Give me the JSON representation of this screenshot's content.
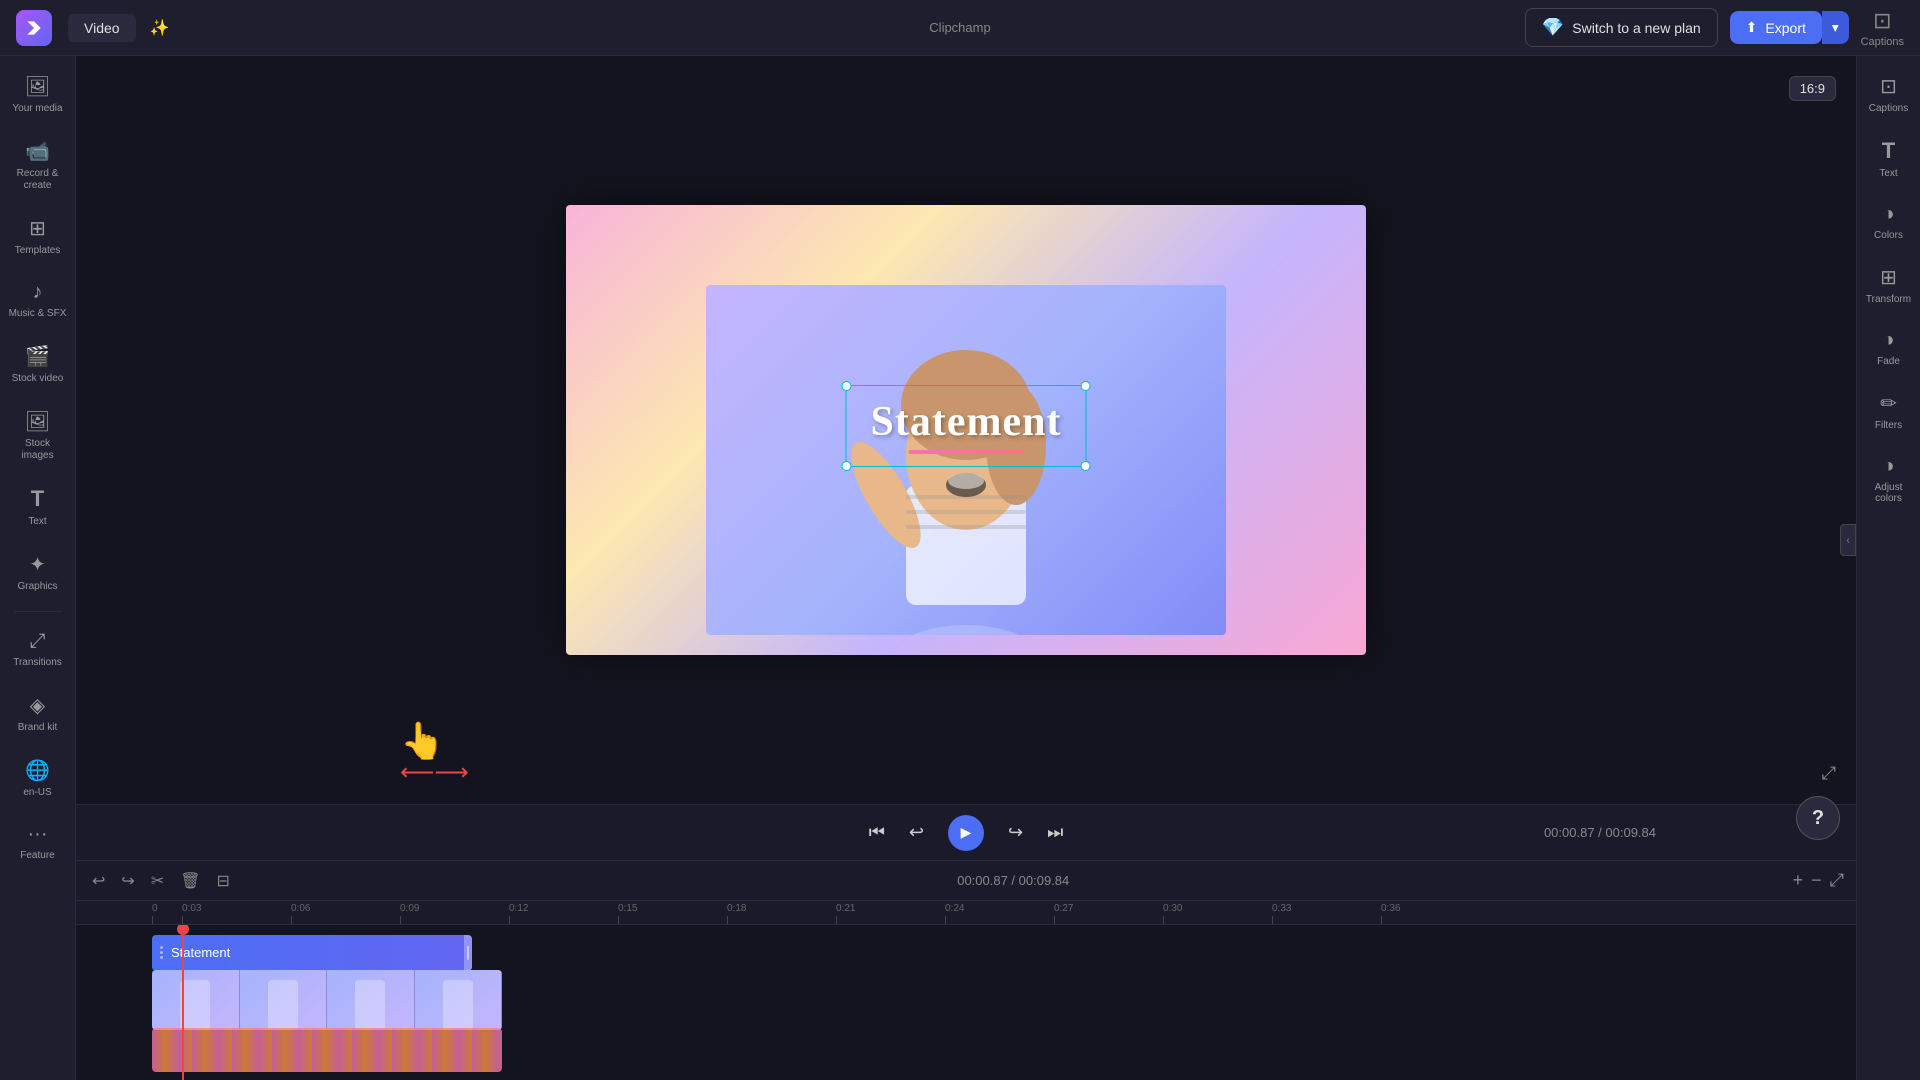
{
  "app": {
    "logo_label": "Clipchamp",
    "center_logo": "Clipchamp"
  },
  "topbar": {
    "tab_video_label": "Video",
    "switch_plan_label": "Switch to a new plan",
    "export_label": "Export",
    "captions_label": "Captions"
  },
  "left_sidebar": {
    "items": [
      {
        "id": "your-media",
        "label": "Your media",
        "icon": "🖼"
      },
      {
        "id": "record-create",
        "label": "Record &\ncreate",
        "icon": "📹"
      },
      {
        "id": "templates",
        "label": "Templates",
        "icon": "⊞"
      },
      {
        "id": "music-sfx",
        "label": "Music & SFX",
        "icon": "♪"
      },
      {
        "id": "stock-video",
        "label": "Stock video",
        "icon": "🎬"
      },
      {
        "id": "stock-images",
        "label": "Stock images",
        "icon": "🖼"
      },
      {
        "id": "text",
        "label": "Text",
        "icon": "T"
      },
      {
        "id": "graphics",
        "label": "Graphics",
        "icon": "✦"
      },
      {
        "id": "transitions",
        "label": "Transitions",
        "icon": "⤢"
      },
      {
        "id": "brand-kit",
        "label": "Brand kit",
        "icon": "◈"
      },
      {
        "id": "en-us",
        "label": "en-US",
        "icon": "🌐"
      },
      {
        "id": "feature",
        "label": "Feature",
        "icon": "···"
      }
    ]
  },
  "preview": {
    "text_content": "Statement",
    "aspect_ratio": "16:9"
  },
  "playback": {
    "current_time": "00:00.87",
    "total_time": "00:09.84",
    "time_display": "00:00.87 / 00:09.84"
  },
  "timeline": {
    "time_display": "00:00.87 / 00:09.84",
    "tracks": [
      {
        "id": "text-track",
        "label": "Statement",
        "type": "text"
      },
      {
        "id": "video-track",
        "label": "",
        "type": "video"
      },
      {
        "id": "music-track",
        "label": "",
        "type": "music"
      }
    ],
    "ruler_marks": [
      "0",
      "0:03",
      "0:06",
      "0:09",
      "0:12",
      "0:15",
      "0:18",
      "0:21",
      "0:24",
      "0:27",
      "0:30",
      "0:33",
      "0:36"
    ]
  },
  "right_sidebar": {
    "items": [
      {
        "id": "captions",
        "label": "Captions",
        "icon": "⊡"
      },
      {
        "id": "text",
        "label": "Text",
        "icon": "T"
      },
      {
        "id": "colors",
        "label": "Colors",
        "icon": "◑"
      },
      {
        "id": "transform",
        "label": "Transform",
        "icon": "⊞"
      },
      {
        "id": "fade",
        "label": "Fade",
        "icon": "◑"
      },
      {
        "id": "filters",
        "label": "Filters",
        "icon": "✏"
      },
      {
        "id": "adjust-colors",
        "label": "Adjust colors",
        "icon": "◑"
      }
    ]
  }
}
